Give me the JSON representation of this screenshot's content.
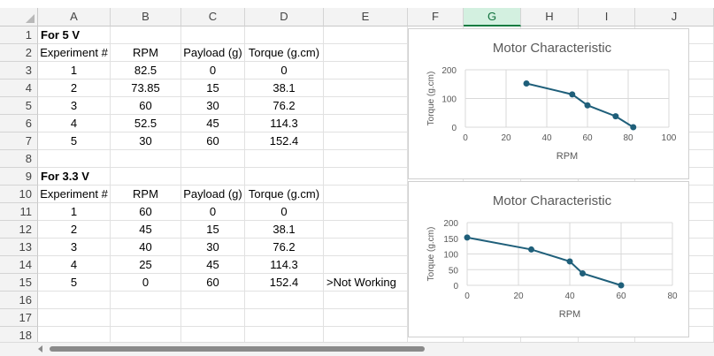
{
  "columns": [
    "A",
    "B",
    "C",
    "D",
    "E",
    "F",
    "G",
    "H",
    "I",
    "J"
  ],
  "selected_column": "G",
  "rows": [
    "1",
    "2",
    "3",
    "4",
    "5",
    "6",
    "7",
    "8",
    "9",
    "10",
    "11",
    "12",
    "13",
    "14",
    "15",
    "16",
    "17",
    "18"
  ],
  "cells": {
    "A1": "For 5 V",
    "A2": "Experiment #",
    "B2": "RPM",
    "C2": "Payload (g)",
    "D2": "Torque (g.cm)",
    "A3": "1",
    "B3": "82.5",
    "C3": "0",
    "D3": "0",
    "A4": "2",
    "B4": "73.85",
    "C4": "15",
    "D4": "38.1",
    "A5": "3",
    "B5": "60",
    "C5": "30",
    "D5": "76.2",
    "A6": "4",
    "B6": "52.5",
    "C6": "45",
    "D6": "114.3",
    "A7": "5",
    "B7": "30",
    "C7": "60",
    "D7": "152.4",
    "A9": "For 3.3 V",
    "A10": "Experiment #",
    "B10": "RPM",
    "C10": "Payload (g)",
    "D10": "Torque (g.cm)",
    "A11": "1",
    "B11": "60",
    "C11": "0",
    "D11": "0",
    "A12": "2",
    "B12": "45",
    "C12": "15",
    "D12": "38.1",
    "A13": "3",
    "B13": "40",
    "C13": "30",
    "D13": "76.2",
    "A14": "4",
    "B14": "25",
    "C14": "45",
    "D14": "114.3",
    "A15": "5",
    "B15": "0",
    "C15": "60",
    "D15": "152.4",
    "E15": ">Not Working"
  },
  "chart_data": [
    {
      "type": "scatter",
      "title": "Motor Characteristic",
      "xlabel": "RPM",
      "ylabel": "Torque (g.cm)",
      "xlim": [
        0,
        100
      ],
      "ylim": [
        0,
        200
      ],
      "xticks": [
        "0",
        "20",
        "40",
        "60",
        "80",
        "100"
      ],
      "yticks": [
        "0",
        "100",
        "200"
      ],
      "grid": true,
      "series": [
        {
          "x": [
            82.5,
            73.85,
            60,
            52.5,
            30
          ],
          "y": [
            0,
            38.1,
            76.2,
            114.3,
            152.4
          ],
          "color": "#1f5f7a"
        }
      ]
    },
    {
      "type": "scatter",
      "title": "Motor Characteristic",
      "xlabel": "RPM",
      "ylabel": "Torque (g.cm)",
      "xlim": [
        0,
        80
      ],
      "ylim": [
        0,
        200
      ],
      "xticks": [
        "0",
        "20",
        "40",
        "60",
        "80"
      ],
      "yticks": [
        "0",
        "50",
        "100",
        "150",
        "200"
      ],
      "grid": true,
      "series": [
        {
          "x": [
            60,
            45,
            40,
            25,
            0
          ],
          "y": [
            0,
            38.1,
            76.2,
            114.3,
            152.4
          ],
          "color": "#1f5f7a"
        }
      ]
    }
  ],
  "colors": {
    "selected_header": "#107c41",
    "series": "#1f5f7a",
    "grid": "#d9d9d9"
  }
}
